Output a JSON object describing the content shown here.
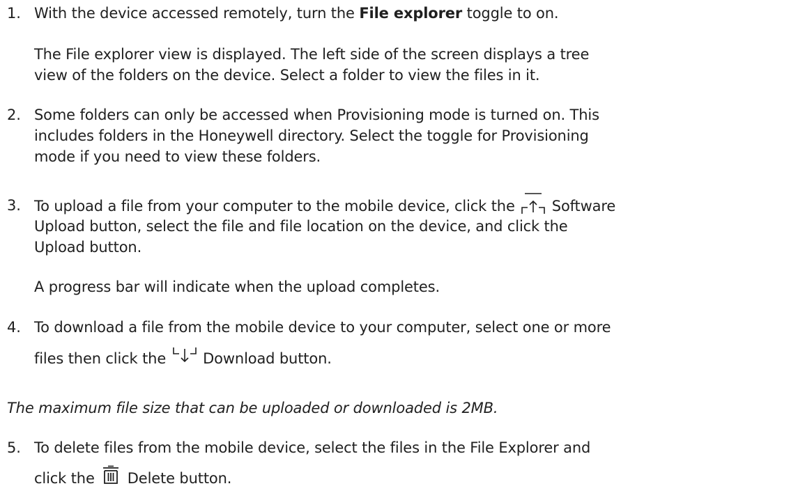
{
  "steps": [
    {
      "number": "1.",
      "text_before": "With the device accessed remotely, turn the ",
      "bold": "File explorer",
      "text_after": " toggle to on.",
      "result": [
        "The File explorer view is displayed. The left side of the screen displays a tree",
        "view of the folders on the device. Select a folder to view the files in it."
      ]
    },
    {
      "number": "2.",
      "lines": [
        "Some folders can only be accessed when Provisioning mode is turned on. This",
        "includes folders in the Honeywell directory. Select the toggle for Provisioning",
        "mode if you need to view these folders."
      ]
    },
    {
      "number": "3.",
      "line1_before": "To upload a file from your computer to the mobile device, click the ",
      "icon": "software-upload-icon",
      "line1_after": " Software",
      "lines": [
        "Upload button, select the file and file location on the device, and click the",
        "Upload button."
      ],
      "result": "A progress bar will indicate when the upload completes."
    },
    {
      "number": "4.",
      "line1": "To download a file from the mobile device to your computer, select one or more",
      "line2_before": "files then click the ",
      "icon": "download-icon",
      "line2_after": " Download button."
    }
  ],
  "note": "The maximum file size that can be uploaded or downloaded is 2MB.",
  "step5": {
    "number": "5.",
    "line1": "To delete files from the mobile device, select the files in the File Explorer and",
    "line2_before": "click the ",
    "icon": "delete-icon",
    "line2_after": " Delete button."
  }
}
